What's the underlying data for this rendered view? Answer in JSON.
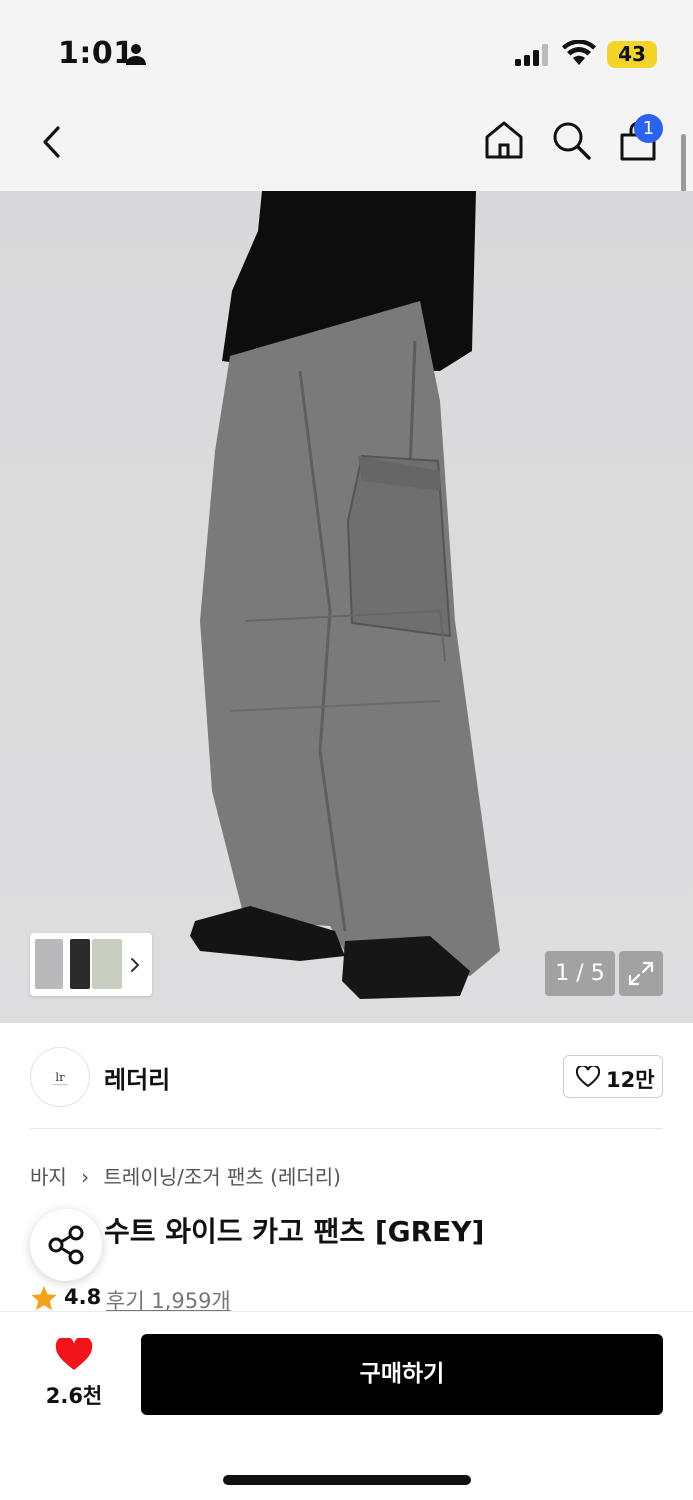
{
  "status_bar": {
    "time": "1:01",
    "battery": "43",
    "battery_color": "#f5d42a"
  },
  "nav": {
    "back_icon": "chevron-left-icon",
    "home_icon": "home-icon",
    "search_icon": "search-icon",
    "cart_icon": "shopping-bag-icon",
    "cart_badge": "1",
    "badge_color": "#2b62ef"
  },
  "gallery": {
    "page_counter": "1 / 5",
    "expand_icon": "expand-icon",
    "thumb_arrow_icon": "chevron-right-icon"
  },
  "brand": {
    "name": "레더리",
    "like_count": "12만"
  },
  "breadcrumb": {
    "items": [
      "바지",
      "트레이닝/조거 팬츠 (레더리)"
    ]
  },
  "product": {
    "title_visible": "수트 와이드 카고 팬츠 [GREY]",
    "rating": "4.8",
    "reviews": "후기 1,959개"
  },
  "bottom_bar": {
    "wish_count": "2.6천",
    "buy_label": "구매하기",
    "heart_color": "#f2141b"
  }
}
